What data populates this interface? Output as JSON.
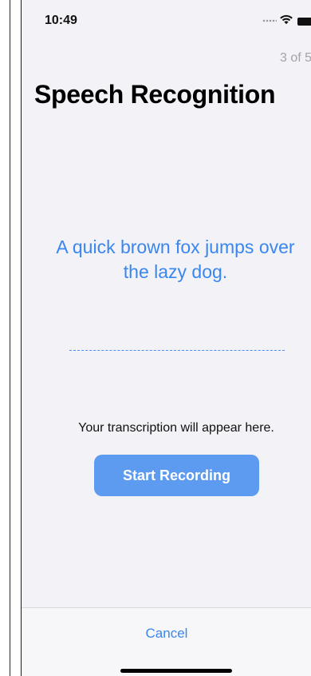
{
  "status_bar": {
    "time": "10:49",
    "icons": [
      "cellular-dots-icon",
      "wifi-icon",
      "battery-icon"
    ]
  },
  "header": {
    "step_counter": "3 of 5",
    "title": "Speech Recognition"
  },
  "main": {
    "prompt": "A quick brown fox jumps over the lazy dog.",
    "transcription_placeholder": "Your transcription will appear here.",
    "record_button_label": "Start Recording"
  },
  "footer": {
    "cancel_label": "Cancel"
  },
  "colors": {
    "accent": "#3a86f0",
    "button_fill": "#5d9bf0",
    "background": "#f2f2f7"
  }
}
